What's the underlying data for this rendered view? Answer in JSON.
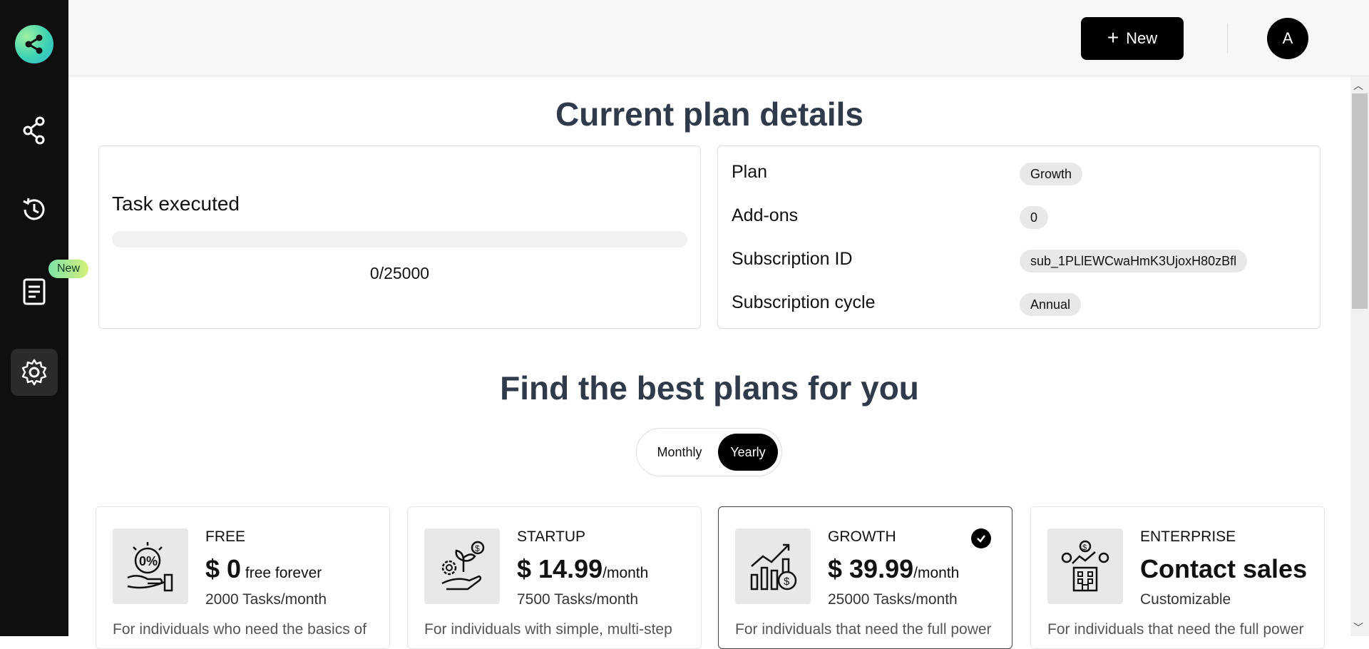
{
  "sidebar": {
    "new_badge": "New",
    "items": [
      {
        "icon": "share-icon"
      },
      {
        "icon": "history-icon"
      },
      {
        "icon": "document-icon"
      },
      {
        "icon": "gear-icon"
      }
    ]
  },
  "topbar": {
    "new_button_label": "New",
    "avatar_initial": "A"
  },
  "current_plan": {
    "title": "Current plan details",
    "task_label": "Task executed",
    "task_count": "0/25000",
    "task_progress": 0,
    "details": [
      {
        "key": "Plan",
        "value": "Growth"
      },
      {
        "key": "Add-ons",
        "value": "0"
      },
      {
        "key": "Subscription ID",
        "value": "sub_1PLlEWCwaHmK3UjoxH80zBfl"
      },
      {
        "key": "Subscription cycle",
        "value": "Annual"
      }
    ]
  },
  "plans_section": {
    "title": "Find the best plans for you",
    "toggle": {
      "monthly": "Monthly",
      "yearly": "Yearly",
      "selected": "Yearly"
    },
    "plans": [
      {
        "name": "FREE",
        "price": "$ 0",
        "suffix": " free forever",
        "tasks": "2000 Tasks/month",
        "desc": "For individuals who need the basics of",
        "icon": "discount-hand-icon",
        "selected": false
      },
      {
        "name": "STARTUP",
        "price": "$ 14.99",
        "suffix": "/month",
        "tasks": "7500 Tasks/month",
        "desc": "For individuals with simple, multi-step",
        "icon": "plant-gear-icon",
        "selected": false
      },
      {
        "name": "GROWTH",
        "price": "$ 39.99",
        "suffix": "/month",
        "tasks": "25000 Tasks/month",
        "desc": "For individuals that need the full power",
        "icon": "growth-chart-icon",
        "selected": true
      },
      {
        "name": "ENTERPRISE",
        "price": "Contact sales",
        "suffix": "",
        "tasks": "Customizable",
        "desc": "For individuals that need the full power",
        "icon": "enterprise-building-icon",
        "selected": false
      }
    ]
  },
  "colors": {
    "accent_green": "#3ed3b4",
    "dark": "#000000",
    "heading": "#2f3a4a"
  }
}
